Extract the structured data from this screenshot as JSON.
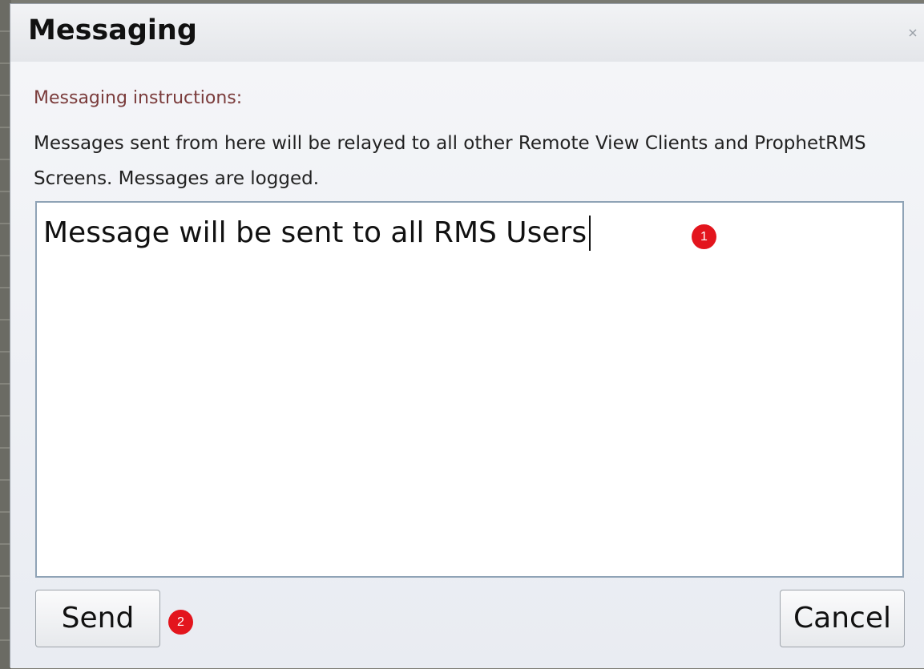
{
  "dialog": {
    "title": "Messaging",
    "close_icon": "close-icon",
    "instructions_label": "Messaging instructions:",
    "instructions_text": "Messages sent from here will be relayed to all other Remote View Clients and ProphetRMS Screens. Messages are logged.",
    "message_value": "Message will be sent to all RMS Users",
    "send_label": "Send",
    "cancel_label": "Cancel",
    "annotations": {
      "step1": "1",
      "step2": "2"
    },
    "colors": {
      "instructions_label": "#7a3b3b",
      "badge": "#e3151d",
      "textbox_border": "#8fa3b6"
    }
  }
}
